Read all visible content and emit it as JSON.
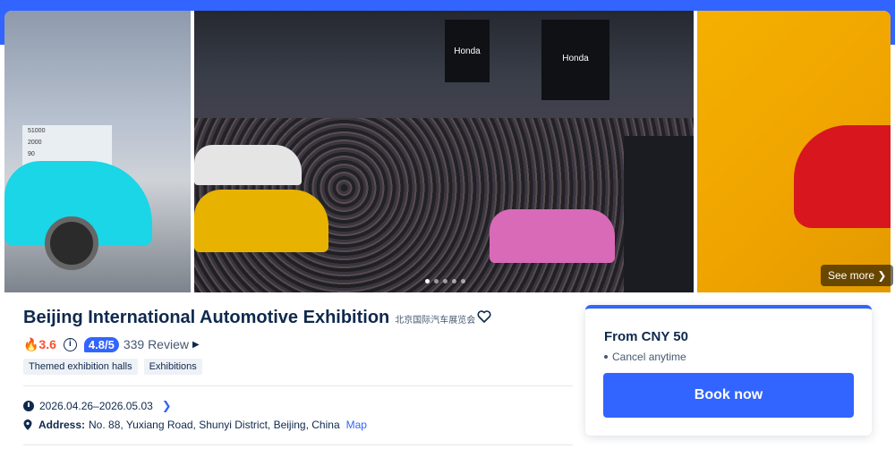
{
  "gallery": {
    "left_screen_lines": [
      "51000",
      "2000",
      "90"
    ],
    "booth_labels": [
      "Honda",
      "Honda"
    ],
    "see_more_label": "See more ❯",
    "dot_count": 5,
    "active_dot": 0
  },
  "product": {
    "title": "Beijing International Automotive Exhibition",
    "title_cn": "北京国际汽车展览会",
    "heat": "🔥3.6",
    "info_glyph": "i",
    "score": "4.8/5",
    "reviews": "339 Review",
    "reviews_caret": "▶",
    "tags": [
      "Themed exhibition halls",
      "Exhibitions"
    ],
    "dates": "2026.04.26–2026.05.03",
    "dates_chevron": "❯",
    "address_label": "Address:",
    "address": "No. 88, Yuxiang Road, Shunyi District, Beijing, China",
    "map_link": "Map"
  },
  "booking": {
    "price": "From CNY 50",
    "cancel": "Cancel anytime",
    "book_label": "Book now"
  },
  "colors": {
    "accent": "#3264ff",
    "text": "#0f294d",
    "heat": "#ff4d2e"
  }
}
